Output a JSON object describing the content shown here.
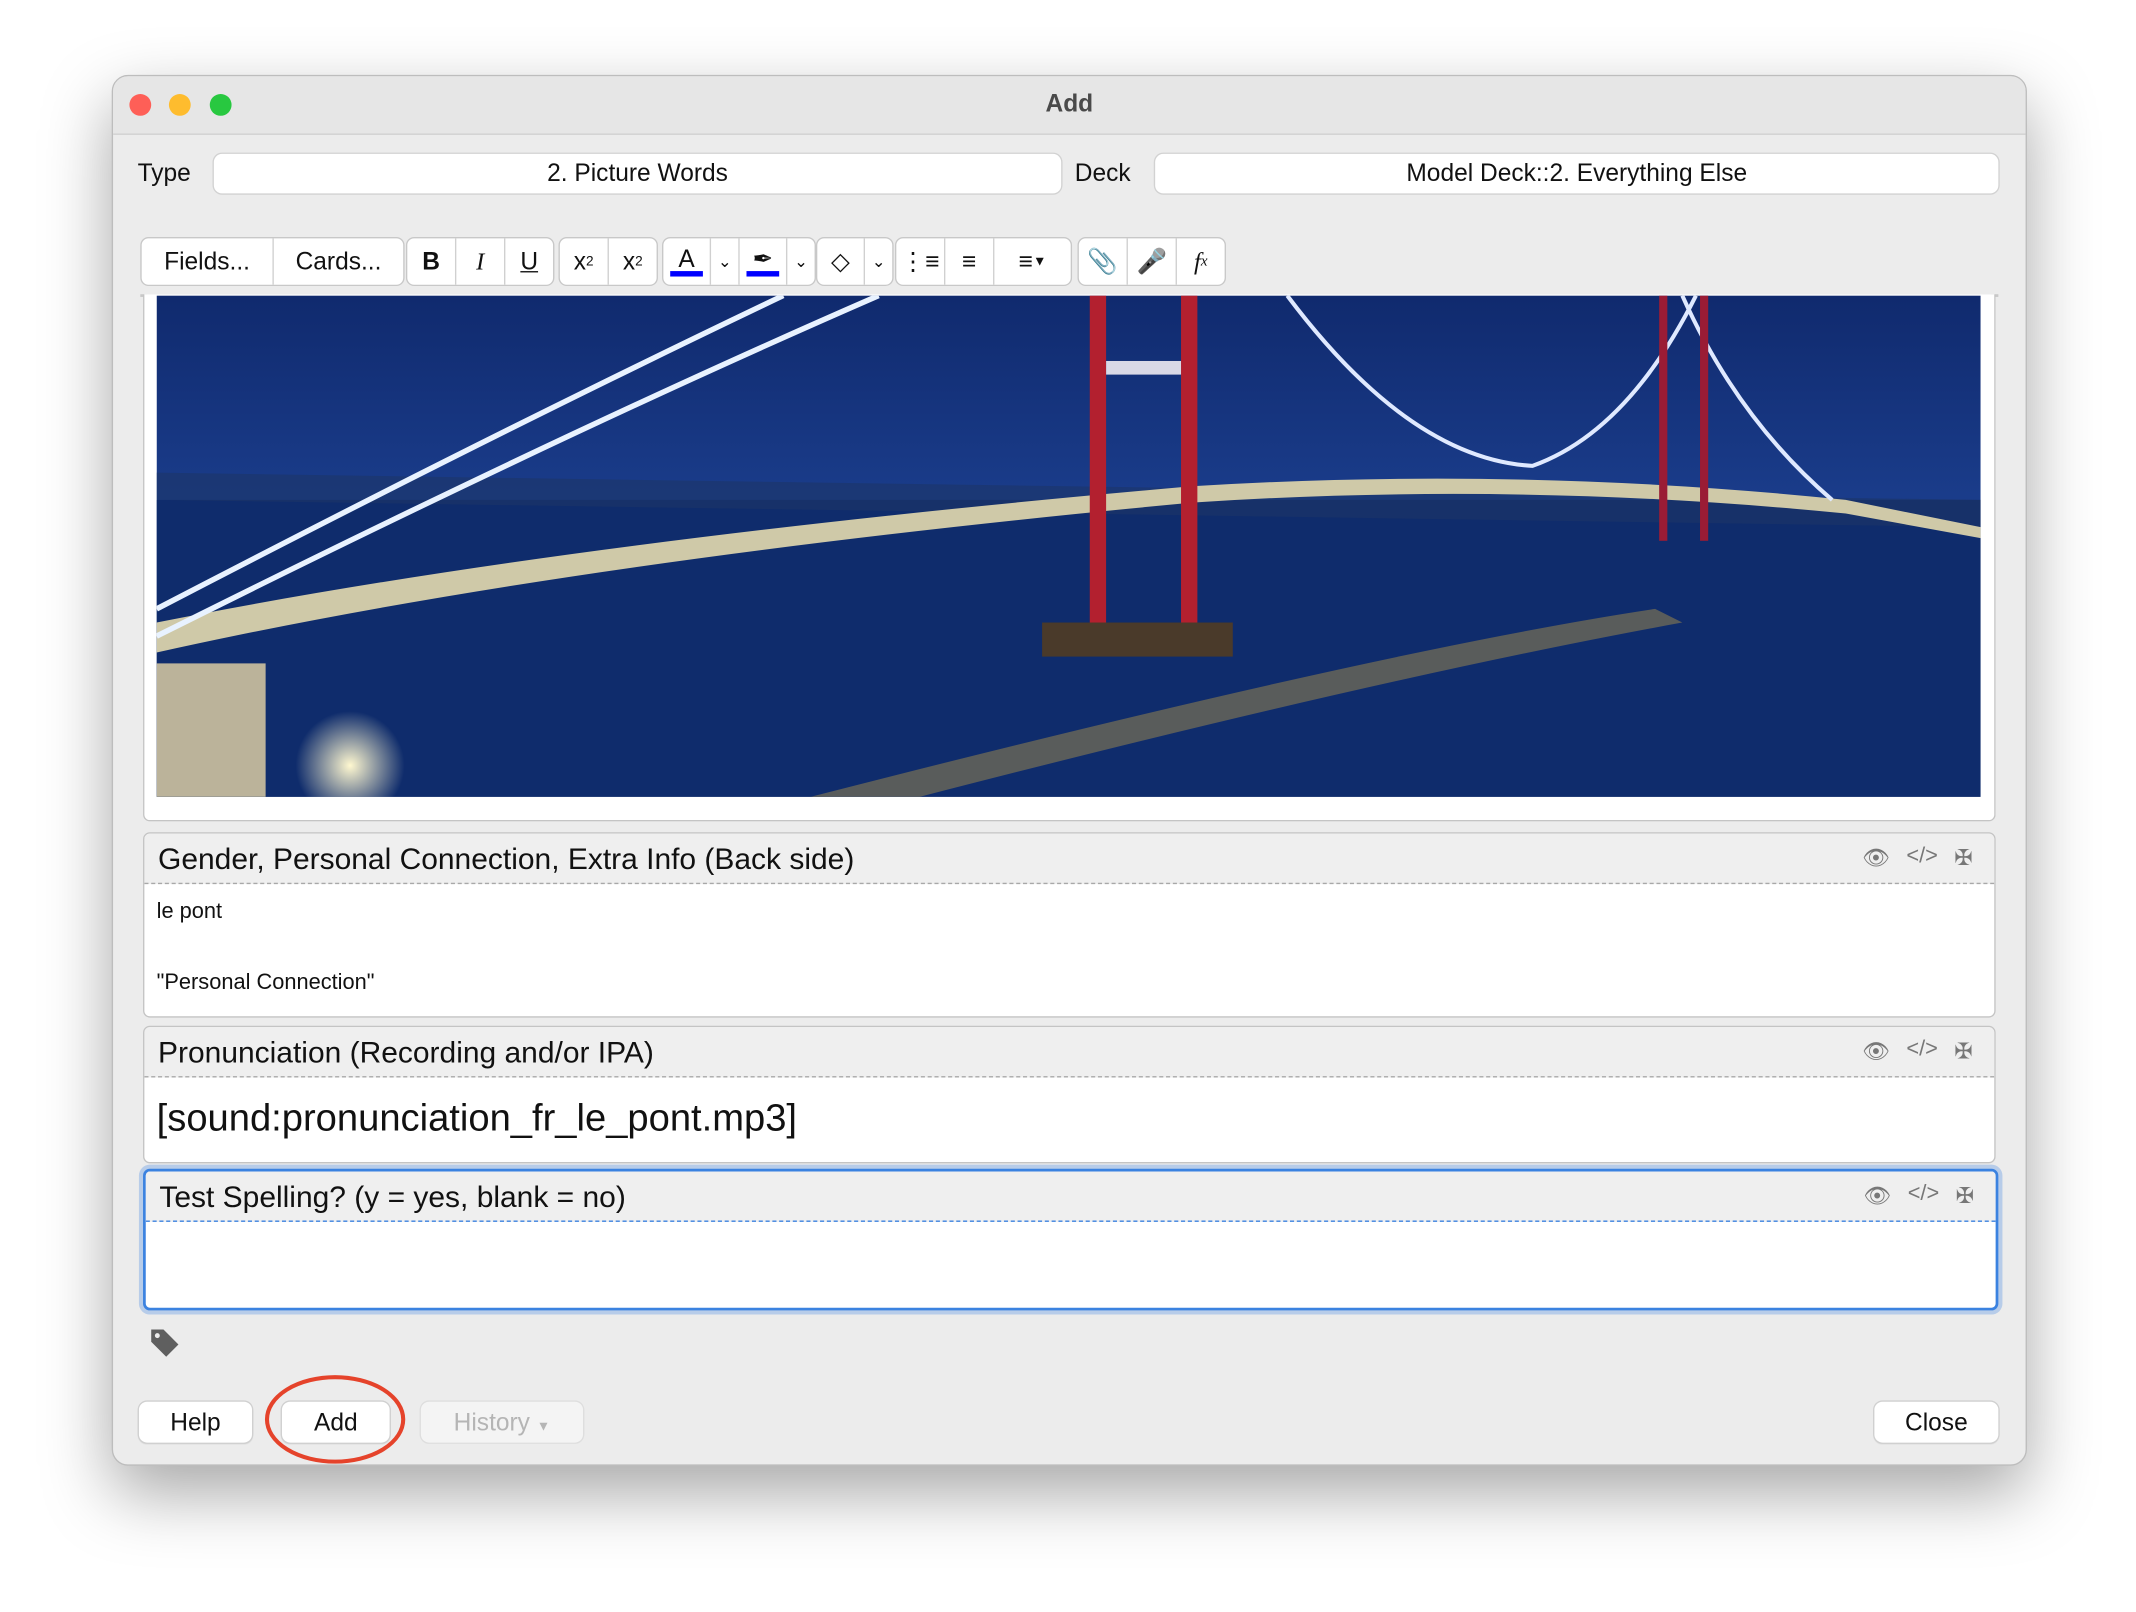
{
  "window": {
    "title": "Add"
  },
  "top_bar": {
    "type_label": "Type",
    "type_value": "2. Picture Words",
    "deck_label": "Deck",
    "deck_value": "Model Deck::2. Everything Else"
  },
  "toolbar": {
    "fields_label": "Fields...",
    "cards_label": "Cards...",
    "bold": "B",
    "italic": "I",
    "underline": "U",
    "text_color": "#0000ff",
    "highlight_color": "#0000ff"
  },
  "fields": [
    {
      "name": "",
      "content": "bridge photo"
    },
    {
      "name": "Gender, Personal Connection, Extra Info (Back side)",
      "lines": [
        "le pont",
        "\"Personal Connection\""
      ]
    },
    {
      "name": "Pronunciation (Recording and/or IPA)",
      "content": "[sound:pronunciation_fr_le_pont.mp3]"
    },
    {
      "name": "Test Spelling? (y = yes, blank = no)",
      "content": ""
    }
  ],
  "buttons": {
    "help": "Help",
    "add": "Add",
    "history": "History",
    "close": "Close"
  },
  "annotation": {
    "color": "#e5432b",
    "target": "Add"
  },
  "colors": {
    "focus": "#3b82e0"
  }
}
